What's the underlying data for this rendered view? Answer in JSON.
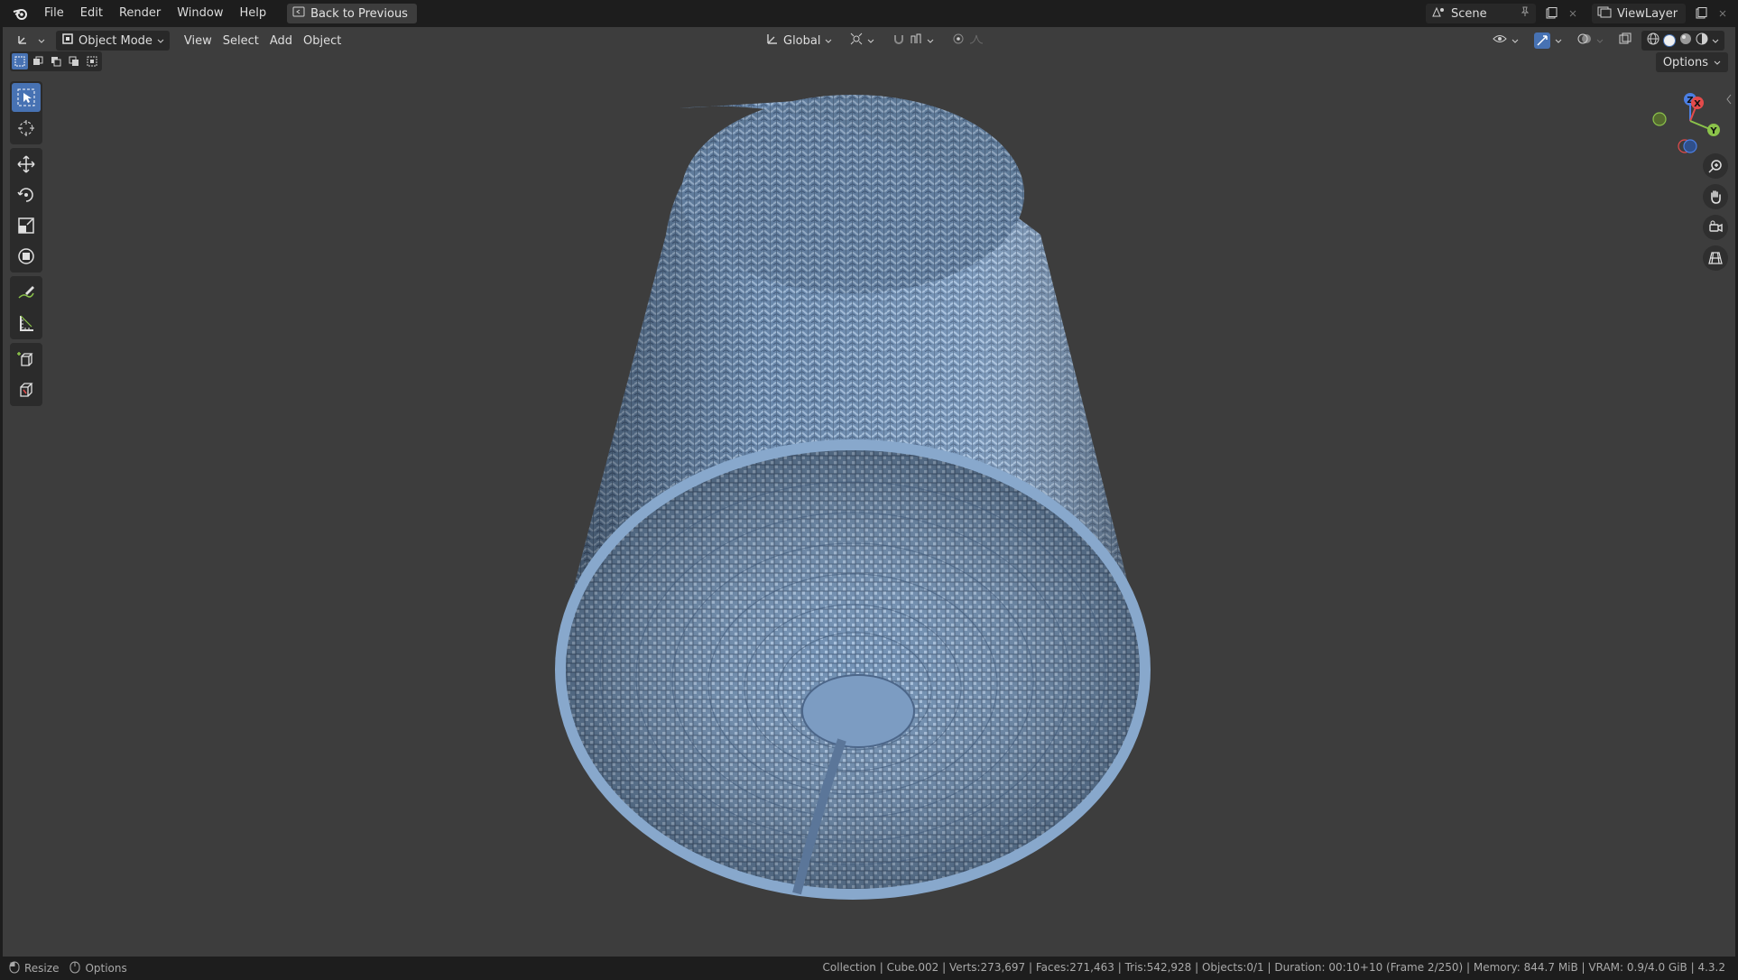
{
  "topbar": {
    "menus": [
      "File",
      "Edit",
      "Render",
      "Window",
      "Help"
    ],
    "back_label": "Back to Previous",
    "scene_name": "Scene",
    "view_layer_name": "ViewLayer"
  },
  "viewport_header": {
    "mode_label": "Object Mode",
    "menus": [
      "View",
      "Select",
      "Add",
      "Object"
    ],
    "transform_orientation": "Global",
    "options_label": "Options"
  },
  "gizmo": {
    "x_label": "X",
    "y_label": "Y",
    "z_label": "Z"
  },
  "statusbar": {
    "left_items": [
      "Resize",
      "Options"
    ],
    "info": "Collection | Cube.002 | Verts:273,697 | Faces:271,463 | Tris:542,928 | Objects:0/1 | Duration: 00:10+10 (Frame 2/250) | Memory: 844.7 MiB | VRAM: 0.9/4.0 GiB | 4.3.2"
  },
  "colors": {
    "viewport_bg": "#3d3d3d",
    "chrome_bg": "#1d1d1d",
    "accent": "#4772b3",
    "mesh": "#7d9cc0",
    "axis_x": "#e44b4b",
    "axis_y": "#8bc34a",
    "axis_z": "#4b7fe4"
  }
}
